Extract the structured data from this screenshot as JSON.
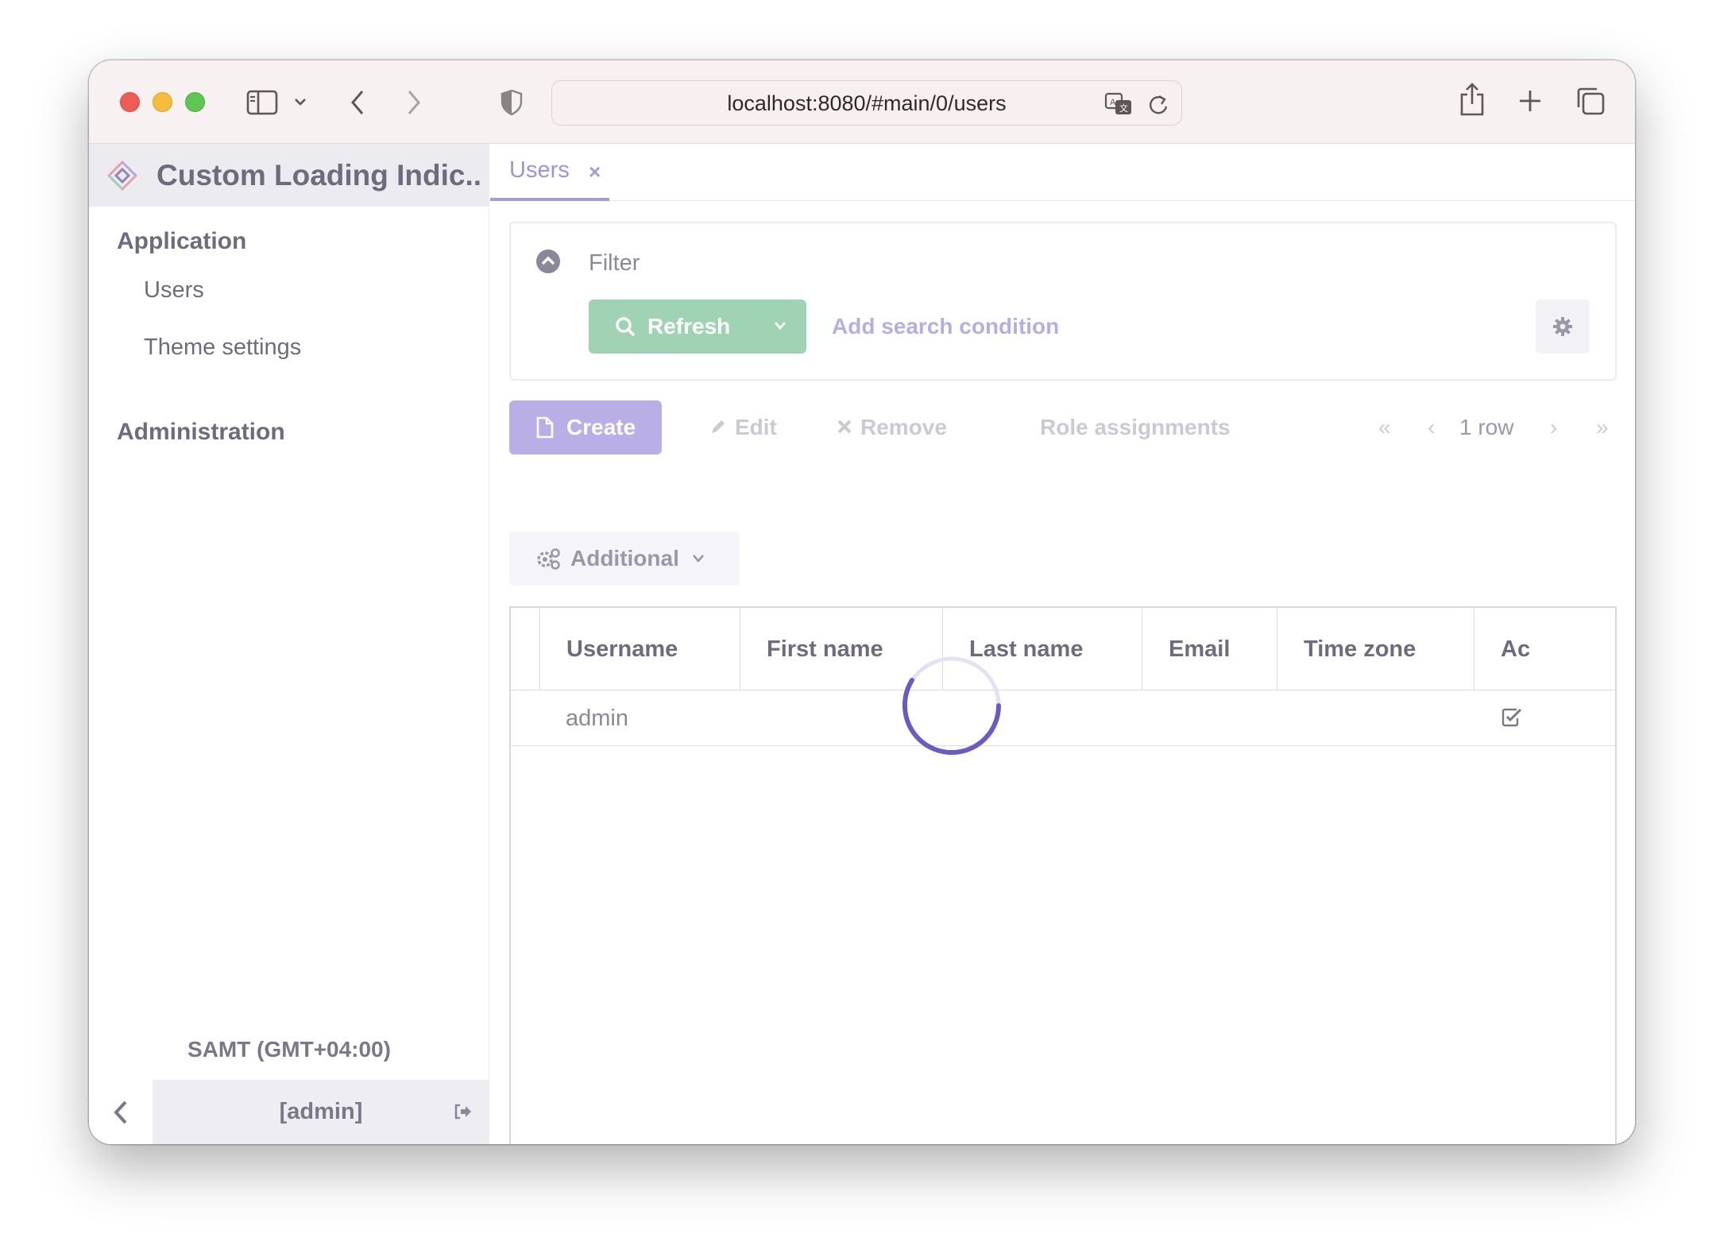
{
  "browser": {
    "url": "localhost:8080/#main/0/users",
    "icons": [
      "sidebar-toggle-icon",
      "chevron-down-icon",
      "back-icon",
      "forward-icon",
      "shield-icon",
      "translate-icon",
      "reload-icon",
      "share-icon",
      "new-tab-icon",
      "tabs-overview-icon"
    ]
  },
  "app": {
    "title": "Custom Loading Indic...",
    "accent": "#a79ad6",
    "success": "#9fd3b3"
  },
  "sidebar": {
    "groups": [
      {
        "label": "Application",
        "items": [
          {
            "label": "Users"
          },
          {
            "label": "Theme settings"
          }
        ]
      },
      {
        "label": "Administration",
        "items": []
      }
    ],
    "timezone": "SAMT (GMT+04:00)",
    "user": "[admin]"
  },
  "tabs": [
    {
      "label": "Users",
      "close": "×"
    }
  ],
  "filter": {
    "label": "Filter",
    "refresh_label": "Refresh",
    "add_condition_label": "Add search condition"
  },
  "toolbar": {
    "create_label": "Create",
    "edit_label": "Edit",
    "remove_label": "Remove",
    "role_assignments_label": "Role assignments",
    "row_count": "1 row",
    "additional_label": "Additional"
  },
  "table": {
    "columns": [
      "Username",
      "First name",
      "Last name",
      "Email",
      "Time zone",
      "Ac"
    ],
    "rows": [
      {
        "username": "admin",
        "first_name": "",
        "last_name": "",
        "email": "",
        "time_zone": "",
        "active": true
      }
    ]
  }
}
